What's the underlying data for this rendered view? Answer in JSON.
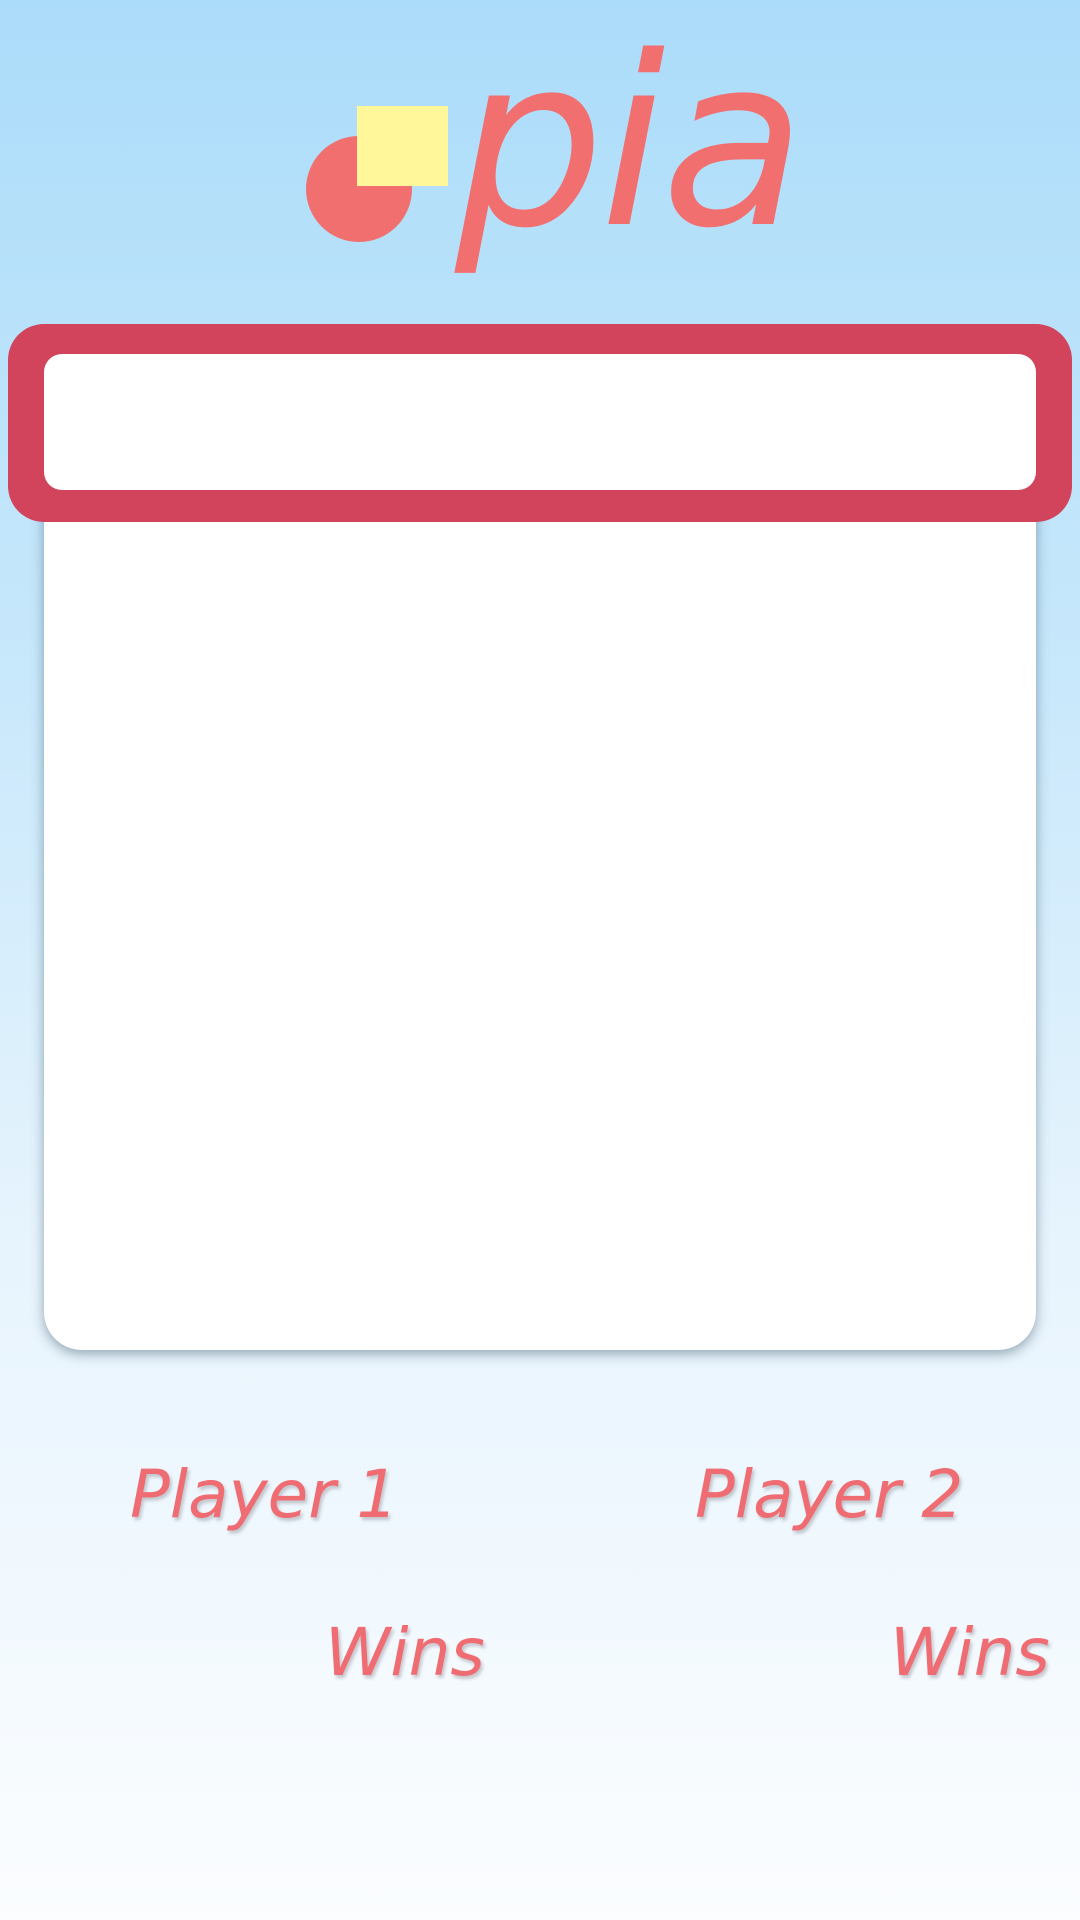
{
  "app": {
    "logo_text": "pia",
    "colors": {
      "accent_red": "#f26f70",
      "frame_red": "#d2435c",
      "logo_yellow": "#fff79a",
      "board": "#ffffff",
      "sky_top": "#abdcfa"
    }
  },
  "status_bar": {
    "text": ""
  },
  "players": [
    {
      "name": "Player 1",
      "wins_label": "Wins"
    },
    {
      "name": "Player 2",
      "wins_label": "Wins"
    }
  ]
}
